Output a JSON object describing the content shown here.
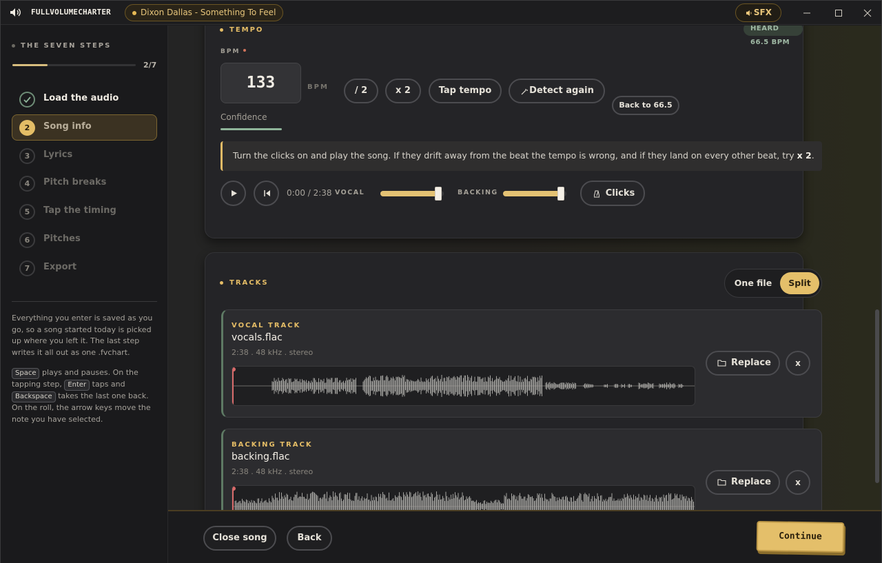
{
  "titlebar": {
    "app_name": "FULLVOLUMECHARTER",
    "song": "Dixon Dallas - Something To Feel",
    "sfx_label": "SFX",
    "icons": [
      "speaker-icon",
      "minimize-icon",
      "maximize-icon",
      "close-icon"
    ]
  },
  "sidebar": {
    "heading": "THE SEVEN STEPS",
    "progress": {
      "current": 2,
      "total": 7,
      "label": "2/7"
    },
    "steps": [
      {
        "num": "1",
        "label": "Load the audio",
        "state": "done"
      },
      {
        "num": "2",
        "label": "Song info",
        "state": "active"
      },
      {
        "num": "3",
        "label": "Lyrics",
        "state": "todo"
      },
      {
        "num": "4",
        "label": "Pitch breaks",
        "state": "todo"
      },
      {
        "num": "5",
        "label": "Tap the timing",
        "state": "todo"
      },
      {
        "num": "6",
        "label": "Pitches",
        "state": "todo"
      },
      {
        "num": "7",
        "label": "Export",
        "state": "todo"
      }
    ],
    "note1": "Everything you enter is saved as you go, so a song started today is picked up where you left it. The last step writes it all out as one .fvchart.",
    "note2": {
      "k1": "Space",
      "t1": " plays and pauses. On the tapping step, ",
      "k2": "Enter",
      "t2": " taps and ",
      "k3": "Backspace",
      "t3": " takes the last one back. On the roll, the arrow keys move the note you have selected."
    }
  },
  "tempo": {
    "title": "TEMPO",
    "heard_badge": "HEARD 66.5 BPM",
    "bpm_label": "BPM",
    "bpm_value": "133",
    "bpm_unit": "BPM",
    "buttons": {
      "half": "/ 2",
      "double": "x 2",
      "tap": "Tap tempo",
      "detect": "Detect again",
      "back": "Back to 66.5"
    },
    "confidence_label": "Confidence",
    "hint_pre": "Turn the clicks on and play the song. If they drift away from the beat the tempo is wrong, and if they land on every other beat, try ",
    "hint_bold": "x 2",
    "hint_post": ".",
    "time": "0:00 / 2:38",
    "vocal_label": "VOCAL",
    "vocal_level": 0.95,
    "backing_label": "BACKING",
    "backing_level": 0.95,
    "clicks_label": "Clicks"
  },
  "tracks": {
    "title": "TRACKS",
    "toggle": {
      "one_file": "One file",
      "split": "Split",
      "selected": "Split"
    },
    "items": [
      {
        "kind": "VOCAL TRACK",
        "file": "vocals.flac",
        "meta": "2:38 . 48 kHz . stereo",
        "replace": "Replace",
        "remove": "x"
      },
      {
        "kind": "BACKING TRACK",
        "file": "backing.flac",
        "meta": "2:38 . 48 kHz . stereo",
        "replace": "Replace",
        "remove": "x"
      }
    ]
  },
  "footer": {
    "close_song": "Close song",
    "back": "Back",
    "continue": "Continue"
  },
  "colors": {
    "accent": "#e4bf6a",
    "success": "#8fb59a",
    "playhead": "#d86a6a"
  }
}
